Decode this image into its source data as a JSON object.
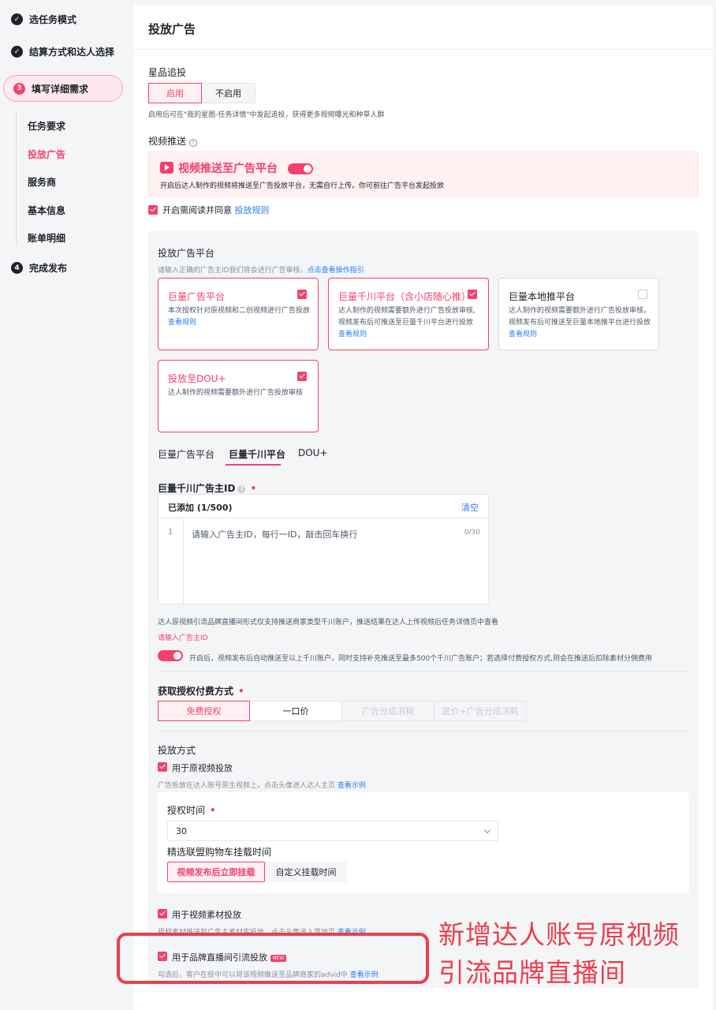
{
  "sidebar": {
    "steps": [
      {
        "num": "✓",
        "label": "选任务模式"
      },
      {
        "num": "✓",
        "label": "结算方式和达人选择"
      },
      {
        "num": "3",
        "label": "填写详细需求"
      },
      {
        "num": "4",
        "label": "完成发布"
      }
    ],
    "substeps": [
      "任务要求",
      "投放广告",
      "服务商",
      "基本信息",
      "账单明细"
    ]
  },
  "page_title": "投放广告",
  "star_chase": {
    "label": "星品追投",
    "options": [
      "启用",
      "不启用"
    ],
    "hint": "启用后可在\"我的星图-任务详情\"中发起追投，获得更多视频曝光和种草人群"
  },
  "video_push": {
    "label": "视频推送",
    "help": "?",
    "title": "视频推送至广告平台",
    "desc": "开启后达人制作的视频将推送至广告投放平台，无需自行上传。你可前往广告平台发起投放",
    "agree_text": "开启需阅读并同意",
    "agree_link": "投放规则"
  },
  "platform": {
    "label": "投放广告平台",
    "hint": "请输入正确的广告主ID我们将会进行广告审核，",
    "hint_link": "点击查看操作指引",
    "cards": [
      {
        "title": "巨量广告平台",
        "desc": "本次授权针对原视频和二创视频进行广告投放",
        "link": "查看规则"
      },
      {
        "title": "巨量千川平台（含小店随心推）",
        "desc": "达人制作的视频需要额外进行广告投放审核, 视频发布后可推送至巨量千川平台进行投放",
        "link": "查看规则"
      },
      {
        "title": "巨量本地推平台",
        "desc": "达人制作的视频需要额外进行广告投放审核，视频发布后可推送至巨量本地推平台进行投放",
        "link": "查看规则"
      },
      {
        "title": "投放至DOU+",
        "desc": "达人制作的视频需要额外进行广告投放审核",
        "link": ""
      }
    ]
  },
  "tabs": [
    "巨量广告平台",
    "巨量千川平台",
    "DOU+"
  ],
  "qianchuan": {
    "label": "巨量千川广告主ID",
    "added": "已添加 (1/500)",
    "clear": "清空",
    "line_no": "1",
    "placeholder": "请输入广告主ID，每行一ID，敲击回车换行",
    "counter": "0/30",
    "note": "达人原视频引流品牌直播间形式仅支持推送商家类型千川账户，推送结果在达人上传视频后任务详情页中查看",
    "error": "请输入广告主ID",
    "auto_push": "开启后，视频发布后自动推送至以上千川账户，同时支持补充推送至最多500个千川广告账户；若选择付费授权方式,则会在推送后扣除素材分佣费用"
  },
  "auth_fee": {
    "label": "获取授权付费方式",
    "options": [
      "免费授权",
      "一口价",
      "广告分成消耗",
      "底价+广告分成消耗"
    ]
  },
  "method": {
    "label": "投放方式",
    "opt1": "用于原视频投放",
    "opt1_hint": "广告投放在达人账号原生视频上，点击头像进入达人主页",
    "opt1_link": "查看示例",
    "auth_time_label": "授权时间",
    "auth_time_value": "30",
    "cart_time_label": "精选联盟购物车挂载时间",
    "cart_options": [
      "视频发布后立即挂载",
      "自定义挂载时间"
    ],
    "opt2": "用于视频素材投放",
    "opt2_hint": "视频素材推送到广告主素材库投放，点击头像进入落地页",
    "opt2_link": "查看示例",
    "opt3": "用于品牌直播间引流投放",
    "opt3_badge": "NEW",
    "opt3_hint": "勾选后，客户在投中可以将该视频推送至品牌商家的advid中",
    "opt3_link": "查看示例"
  },
  "annotation": {
    "line1": "新增达人账号原视频",
    "line2": "引流品牌直播间"
  },
  "colors": {
    "accent": "#f5406e",
    "link": "#2a7bf5",
    "annotation": "#ec3e4c"
  }
}
